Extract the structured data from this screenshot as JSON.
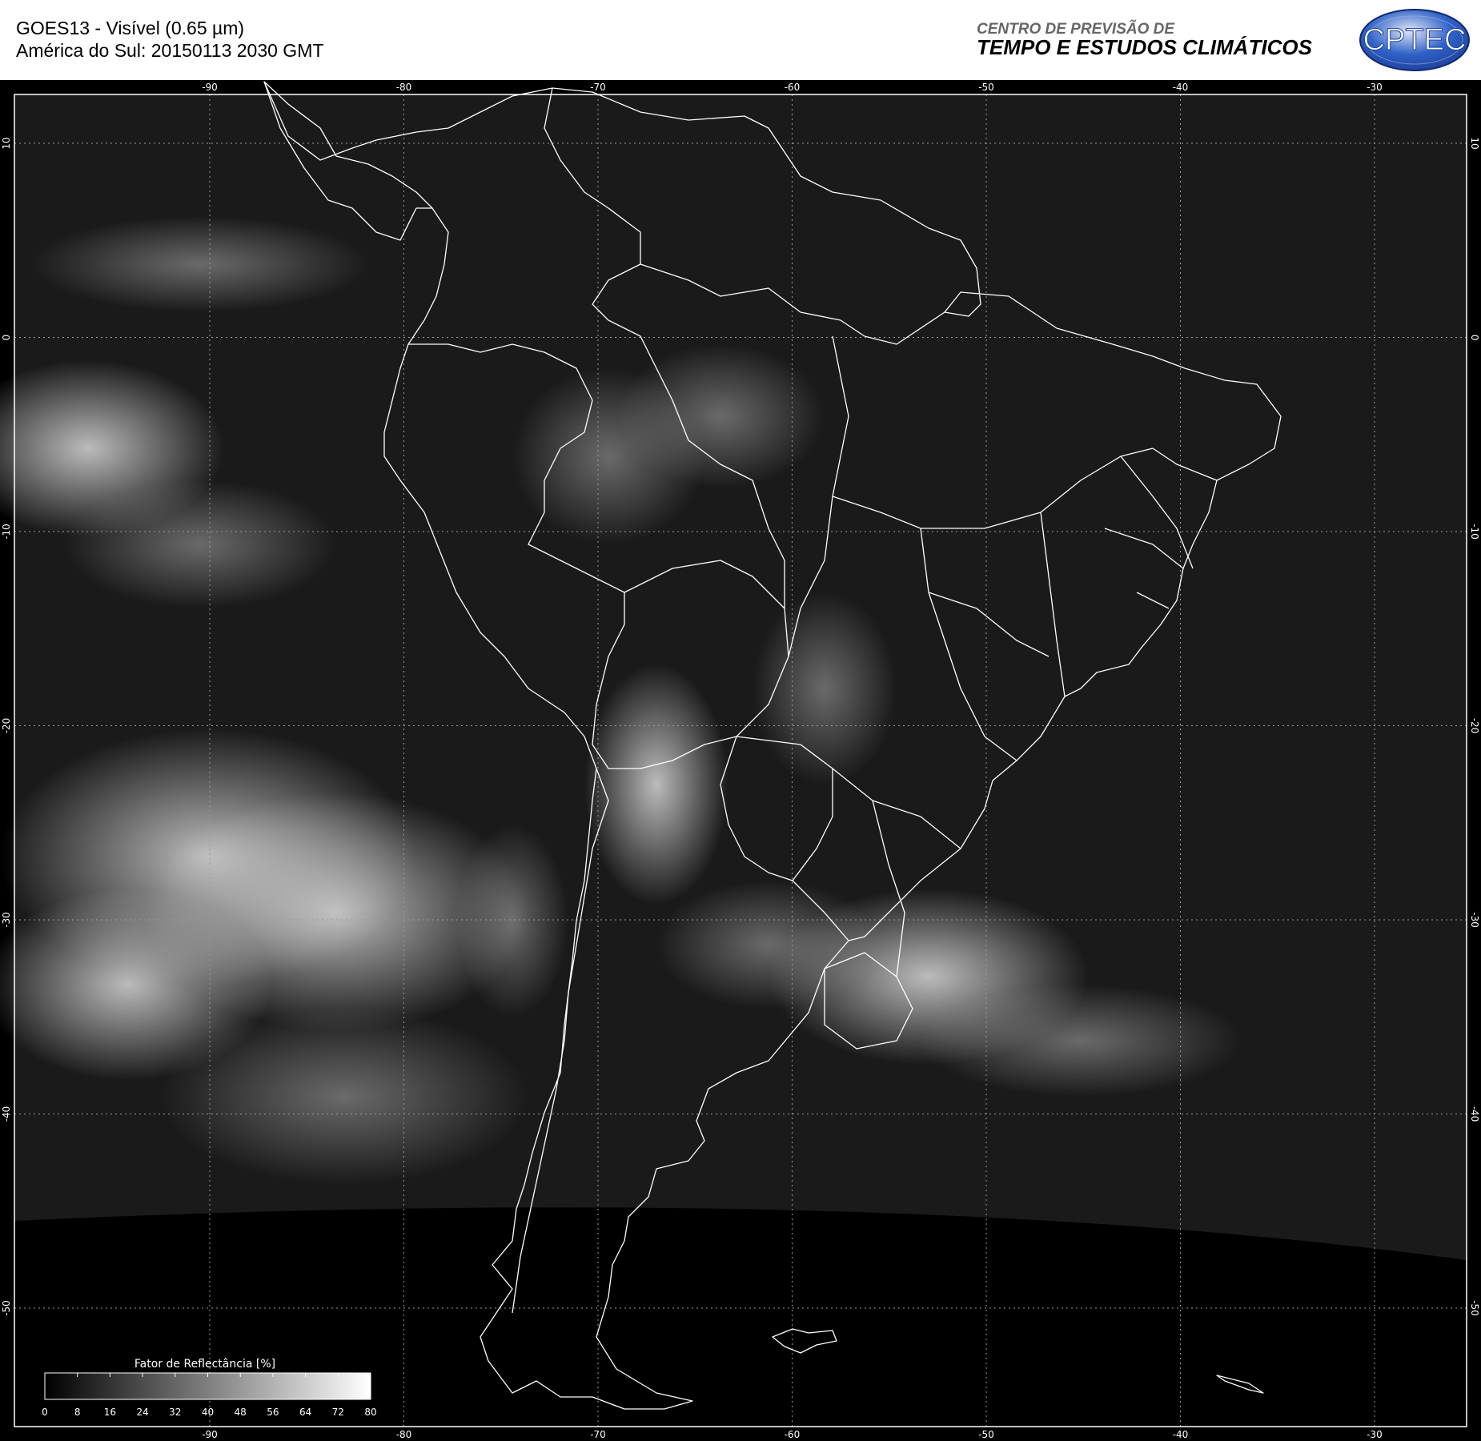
{
  "header": {
    "title_line1": "GOES13 - Visível (0.65 µm)",
    "title_line2": "América do Sul: 20150113 2030 GMT",
    "org_line1": "CENTRO DE PREVISÃO DE",
    "org_line2": "TEMPO E ESTUDOS CLIMÁTICOS",
    "logo_text": "CPTEC",
    "logo_colors": {
      "outer": "#1e3f9a",
      "inner": "#2f62c8",
      "highlight": "#dfe6f5",
      "text": "#ffffff"
    }
  },
  "map": {
    "longitude_ticks": [
      "-90",
      "-80",
      "-70",
      "-60",
      "-50",
      "-40",
      "-30"
    ],
    "latitude_ticks": [
      "10",
      "0",
      "-10",
      "-20",
      "-30",
      "-40",
      "-50"
    ],
    "grid": true,
    "background_color": "#000000",
    "boundary_color": "#ffffff"
  },
  "colorbar": {
    "title": "Fator de Reflectância [%]",
    "ticks": [
      "0",
      "8",
      "16",
      "24",
      "32",
      "40",
      "48",
      "56",
      "64",
      "72",
      "80"
    ],
    "range": [
      0,
      80
    ],
    "gradient": [
      "#000000",
      "#ffffff"
    ]
  }
}
